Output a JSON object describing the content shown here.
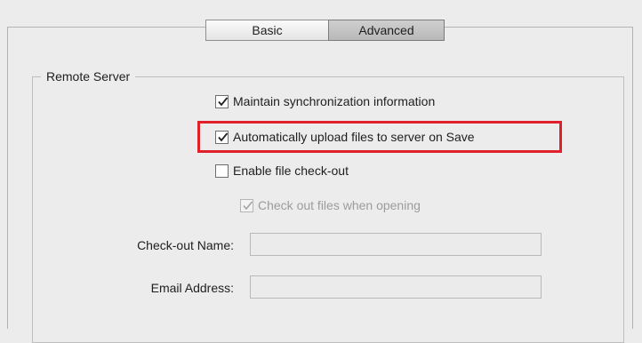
{
  "tabs": [
    {
      "label": "Basic",
      "selected": false
    },
    {
      "label": "Advanced",
      "selected": true
    }
  ],
  "remote_server": {
    "legend": "Remote Server",
    "options": [
      {
        "label": "Maintain synchronization information",
        "checked": true,
        "enabled": true
      },
      {
        "label": "Automatically upload files to server on Save",
        "checked": true,
        "enabled": true,
        "highlighted": true
      },
      {
        "label": "Enable file check-out",
        "checked": false,
        "enabled": true
      },
      {
        "label": "Check out files when opening",
        "checked": true,
        "enabled": false
      }
    ],
    "fields": [
      {
        "label": "Check-out Name:",
        "value": ""
      },
      {
        "label": "Email Address:",
        "value": ""
      }
    ]
  },
  "colors": {
    "highlight": "#e0202a",
    "selected_tab": "#c4c4c4"
  }
}
